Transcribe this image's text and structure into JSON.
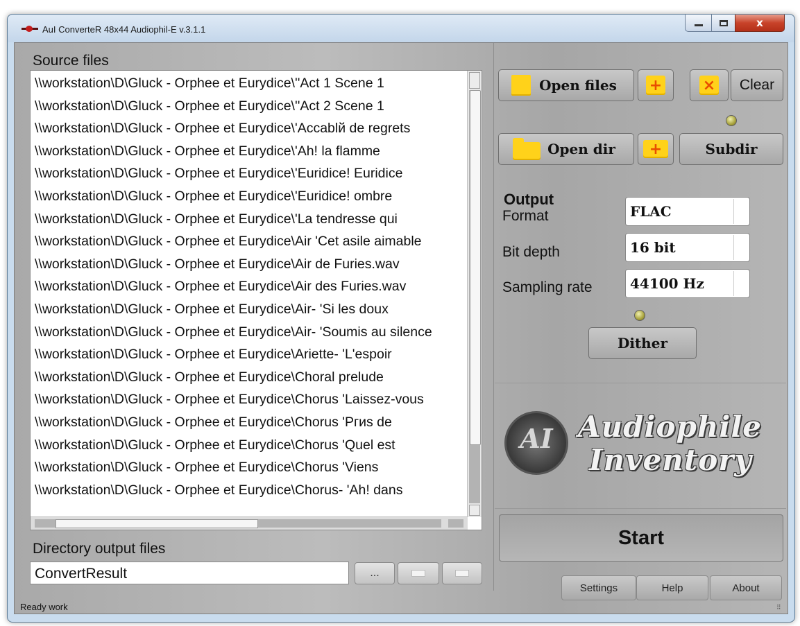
{
  "window": {
    "title": "AuI ConverteR 48x44 Audiophil-E v.3.1.1",
    "controls": {
      "minimize": "minimize",
      "maximize": "maximize",
      "close": "x"
    }
  },
  "source": {
    "label": "Source files",
    "files": [
      "\\\\workstation\\D\\Gluck - Orphee et Eurydice\\''Act 1 Scene 1",
      "\\\\workstation\\D\\Gluck - Orphee et Eurydice\\''Act 2 Scene 1",
      "\\\\workstation\\D\\Gluck - Orphee et Eurydice\\'Accablй de regrets",
      "\\\\workstation\\D\\Gluck - Orphee et Eurydice\\'Ah! la flamme",
      "\\\\workstation\\D\\Gluck - Orphee et Eurydice\\'Euridice! Euridice",
      "\\\\workstation\\D\\Gluck - Orphee et Eurydice\\'Euridice! ombre",
      "\\\\workstation\\D\\Gluck - Orphee et Eurydice\\'La tendresse qui",
      "\\\\workstation\\D\\Gluck - Orphee et Eurydice\\Air 'Cet asile aimable",
      "\\\\workstation\\D\\Gluck - Orphee et Eurydice\\Air de Furies.wav",
      "\\\\workstation\\D\\Gluck - Orphee et Eurydice\\Air des Furies.wav",
      "\\\\workstation\\D\\Gluck - Orphee et Eurydice\\Air- 'Si les doux",
      "\\\\workstation\\D\\Gluck - Orphee et Eurydice\\Air- 'Soumis au silence",
      "\\\\workstation\\D\\Gluck - Orphee et Eurydice\\Ariette- 'L'espoir",
      "\\\\workstation\\D\\Gluck - Orphee et Eurydice\\Choral prelude",
      "\\\\workstation\\D\\Gluck - Orphee et Eurydice\\Chorus 'Laissez-vous",
      "\\\\workstation\\D\\Gluck - Orphee et Eurydice\\Chorus 'Pгиs de",
      "\\\\workstation\\D\\Gluck - Orphee et Eurydice\\Chorus 'Quel est",
      "\\\\workstation\\D\\Gluck - Orphee et Eurydice\\Chorus 'Viens",
      "\\\\workstation\\D\\Gluck - Orphee et Eurydice\\Chorus- 'Ah! dans"
    ]
  },
  "output_dir": {
    "label": "Directory output files",
    "value": "ConvertResult",
    "browse_label": "..."
  },
  "status": "Ready work",
  "toolbar": {
    "open_files": "Open files",
    "clear": "Clear",
    "open_dir": "Open dir",
    "subdir": "Subdir",
    "add_symbol": "+",
    "clear_symbol": "×"
  },
  "output": {
    "title": "Output",
    "format_label": "Format",
    "format_value": "FLAC",
    "bitdepth_label": "Bit depth",
    "bitdepth_value": "16 bit",
    "rate_label": "Sampling rate",
    "rate_value": "44100 Hz",
    "dither": "Dither"
  },
  "logo": {
    "line1": "Audiophile",
    "line2": "Inventory",
    "monogram": "AI"
  },
  "actions": {
    "start": "Start",
    "settings": "Settings",
    "help": "Help",
    "about": "About"
  }
}
